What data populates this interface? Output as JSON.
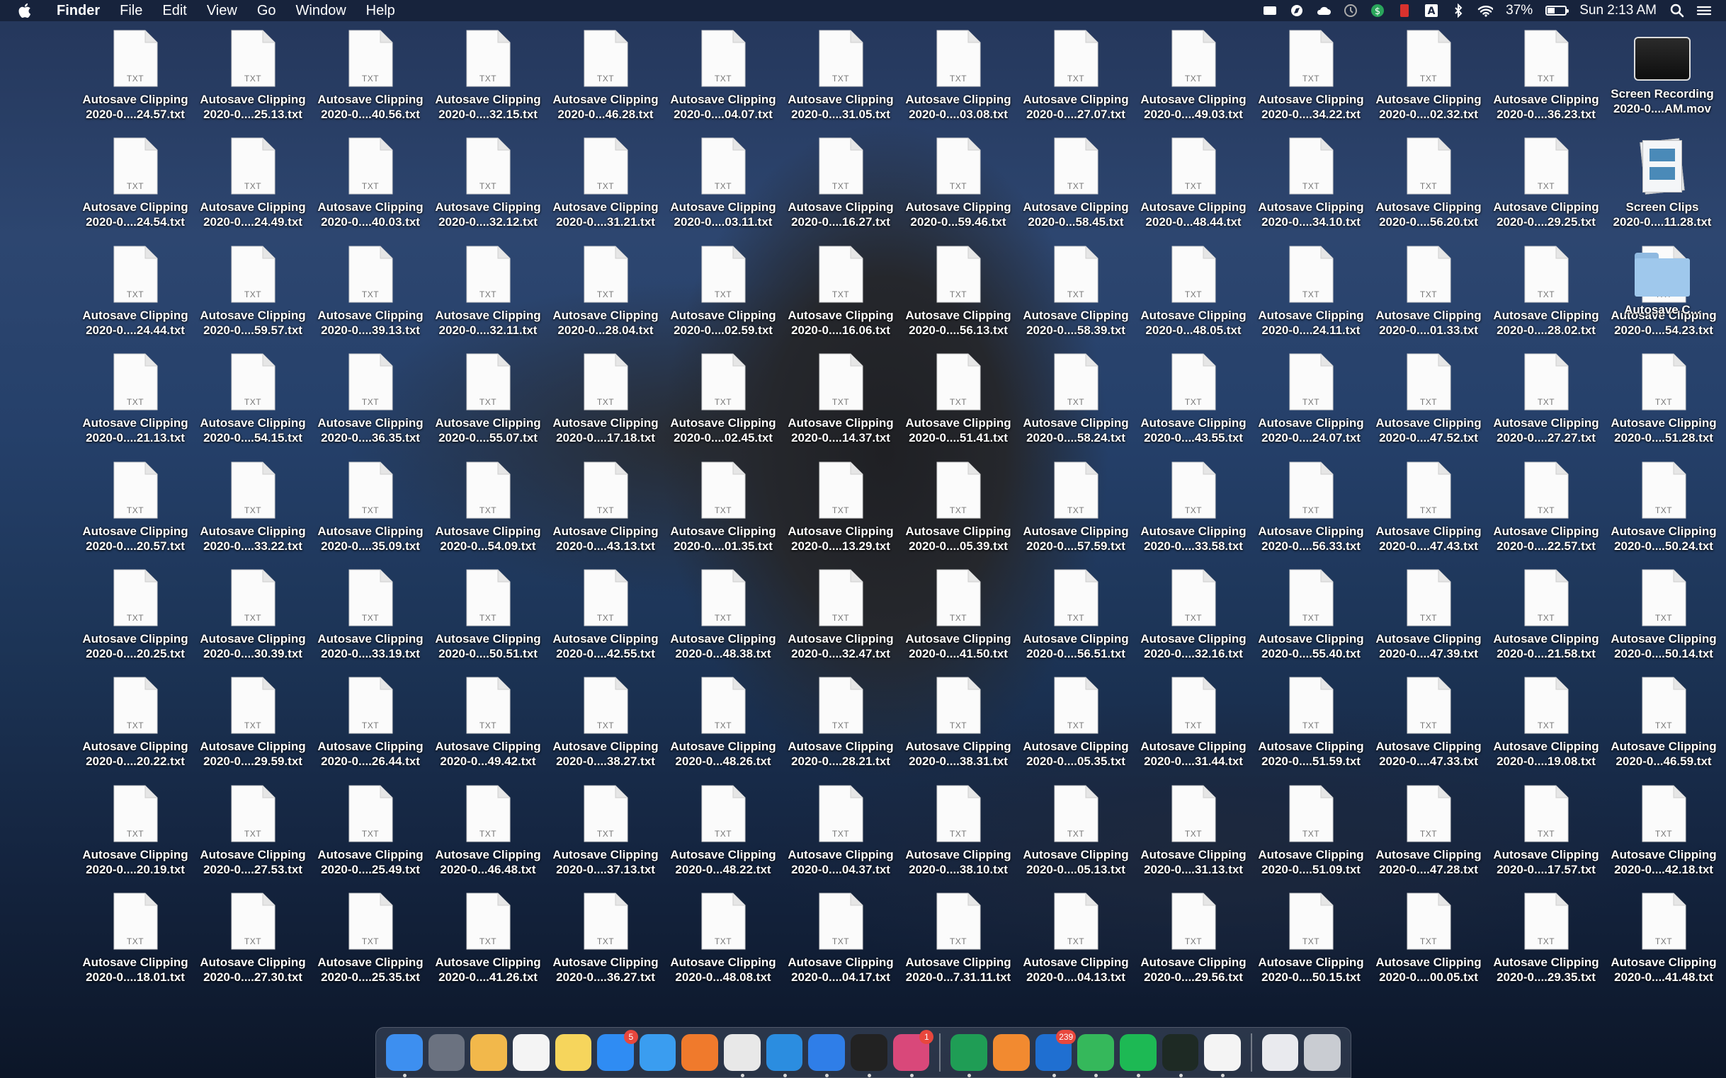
{
  "menubar": {
    "app_name": "Finder",
    "menus": [
      "File",
      "Edit",
      "View",
      "Go",
      "Window",
      "Help"
    ],
    "battery_percent": "37%",
    "battery_level": 0.37,
    "clock": "Sun 2:13 AM",
    "status_icons": [
      "display-icon",
      "compass-icon",
      "cloud-icon",
      "clock-icon",
      "dollar-icon",
      "bookmark-icon",
      "text-icon",
      "bluetooth-icon",
      "wifi-icon"
    ]
  },
  "file_ext": "TXT",
  "file_title": "Autosave Clipping",
  "grid": [
    [
      "2020-0....24.57.txt",
      "2020-0....25.13.txt",
      "2020-0....40.56.txt",
      "2020-0....32.15.txt",
      "2020-0...46.28.txt",
      "2020-0....04.07.txt",
      "2020-0....31.05.txt",
      "2020-0....03.08.txt",
      "2020-0....27.07.txt",
      "2020-0....49.03.txt",
      "2020-0....34.22.txt",
      "2020-0....02.32.txt",
      "2020-0....36.23.txt"
    ],
    [
      "2020-0....24.54.txt",
      "2020-0....24.49.txt",
      "2020-0....40.03.txt",
      "2020-0....32.12.txt",
      "2020-0....31.21.txt",
      "2020-0....03.11.txt",
      "2020-0....16.27.txt",
      "2020-0...59.46.txt",
      "2020-0...58.45.txt",
      "2020-0...48.44.txt",
      "2020-0....34.10.txt",
      "2020-0....56.20.txt",
      "2020-0....29.25.txt"
    ],
    [
      "2020-0....24.44.txt",
      "2020-0....59.57.txt",
      "2020-0....39.13.txt",
      "2020-0....32.11.txt",
      "2020-0...28.04.txt",
      "2020-0....02.59.txt",
      "2020-0....16.06.txt",
      "2020-0....56.13.txt",
      "2020-0....58.39.txt",
      "2020-0...48.05.txt",
      "2020-0....24.11.txt",
      "2020-0....01.33.txt",
      "2020-0....28.02.txt",
      "2020-0....54.23.txt"
    ],
    [
      "2020-0....21.13.txt",
      "2020-0....54.15.txt",
      "2020-0....36.35.txt",
      "2020-0....55.07.txt",
      "2020-0....17.18.txt",
      "2020-0....02.45.txt",
      "2020-0....14.37.txt",
      "2020-0....51.41.txt",
      "2020-0....58.24.txt",
      "2020-0....43.55.txt",
      "2020-0....24.07.txt",
      "2020-0....47.52.txt",
      "2020-0....27.27.txt",
      "2020-0....51.28.txt"
    ],
    [
      "2020-0....20.57.txt",
      "2020-0....33.22.txt",
      "2020-0....35.09.txt",
      "2020-0...54.09.txt",
      "2020-0....43.13.txt",
      "2020-0....01.35.txt",
      "2020-0....13.29.txt",
      "2020-0....05.39.txt",
      "2020-0....57.59.txt",
      "2020-0....33.58.txt",
      "2020-0....56.33.txt",
      "2020-0....47.43.txt",
      "2020-0....22.57.txt",
      "2020-0....50.24.txt"
    ],
    [
      "2020-0....20.25.txt",
      "2020-0....30.39.txt",
      "2020-0....33.19.txt",
      "2020-0....50.51.txt",
      "2020-0....42.55.txt",
      "2020-0...48.38.txt",
      "2020-0....32.47.txt",
      "2020-0....41.50.txt",
      "2020-0....56.51.txt",
      "2020-0....32.16.txt",
      "2020-0....55.40.txt",
      "2020-0....47.39.txt",
      "2020-0....21.58.txt",
      "2020-0....50.14.txt"
    ],
    [
      "2020-0....20.22.txt",
      "2020-0....29.59.txt",
      "2020-0....26.44.txt",
      "2020-0...49.42.txt",
      "2020-0....38.27.txt",
      "2020-0...48.26.txt",
      "2020-0....28.21.txt",
      "2020-0....38.31.txt",
      "2020-0....05.35.txt",
      "2020-0....31.44.txt",
      "2020-0....51.59.txt",
      "2020-0....47.33.txt",
      "2020-0....19.08.txt",
      "2020-0...46.59.txt"
    ],
    [
      "2020-0....20.19.txt",
      "2020-0....27.53.txt",
      "2020-0....25.49.txt",
      "2020-0...46.48.txt",
      "2020-0....37.13.txt",
      "2020-0...48.22.txt",
      "2020-0....04.37.txt",
      "2020-0....38.10.txt",
      "2020-0....05.13.txt",
      "2020-0....31.13.txt",
      "2020-0....51.09.txt",
      "2020-0....47.28.txt",
      "2020-0....17.57.txt",
      "2020-0....42.18.txt"
    ],
    [
      "2020-0....18.01.txt",
      "2020-0....27.30.txt",
      "2020-0....25.35.txt",
      "2020-0....41.26.txt",
      "2020-0....36.27.txt",
      "2020-0...48.08.txt",
      "2020-0....04.17.txt",
      "2020-0...7.31.11.txt",
      "2020-0....04.13.txt",
      "2020-0....29.56.txt",
      "2020-0....50.15.txt",
      "2020-0....00.05.txt",
      "2020-0....29.35.txt",
      "2020-0....41.48.txt"
    ]
  ],
  "right_column": [
    {
      "line1": "Screen Recording",
      "line2": "2020-0....AM.mov",
      "kind": "movie"
    },
    {
      "line1": "Screen Clips",
      "line2": "2020-0....11.28.txt",
      "kind": "stack"
    },
    {
      "line1": "Autosave C...",
      "line2": "",
      "kind": "folder"
    }
  ],
  "dock": {
    "items": [
      {
        "name": "finder-icon",
        "color": "#3d8ff0",
        "dot": true
      },
      {
        "name": "launchpad-icon",
        "color": "#6b7280",
        "dot": false
      },
      {
        "name": "photos-icon",
        "color": "#f2b84b",
        "dot": false
      },
      {
        "name": "reminders-icon",
        "color": "#f4f4f4",
        "dot": false
      },
      {
        "name": "notes-icon",
        "color": "#f6d55c",
        "dot": false
      },
      {
        "name": "app-store-icon",
        "color": "#2f8cf3",
        "dot": false,
        "badge": "5"
      },
      {
        "name": "safari-icon",
        "color": "#3a9df0",
        "dot": false
      },
      {
        "name": "firefox-icon",
        "color": "#f07a2c",
        "dot": false
      },
      {
        "name": "chrome-icon",
        "color": "#e8e8e8",
        "dot": true
      },
      {
        "name": "vscode-icon",
        "color": "#2b8de0",
        "dot": true
      },
      {
        "name": "maps-pin-icon",
        "color": "#2f7ee8",
        "dot": true
      },
      {
        "name": "terminal-icon",
        "color": "#222222",
        "dot": true
      },
      {
        "name": "cleanmymac-icon",
        "color": "#d9487a",
        "dot": true,
        "badge": "1"
      },
      {
        "sep": true
      },
      {
        "name": "robinhood-icon",
        "color": "#1f9d55",
        "dot": true
      },
      {
        "name": "pages-icon",
        "color": "#f28a30",
        "dot": false
      },
      {
        "name": "outlook-icon",
        "color": "#1f6fd1",
        "dot": true,
        "badge": "239"
      },
      {
        "name": "messages-icon",
        "color": "#35b85b",
        "dot": true
      },
      {
        "name": "spotify-icon",
        "color": "#1db954",
        "dot": true
      },
      {
        "name": "activity-monitor-icon",
        "color": "#1e2a24",
        "dot": true
      },
      {
        "name": "textedit-icon",
        "color": "#f4f4f4",
        "dot": true
      },
      {
        "sep": true
      },
      {
        "name": "documents-stack-icon",
        "color": "#e9eaee",
        "dot": false
      },
      {
        "name": "trash-icon",
        "color": "#c9ccd2",
        "dot": false
      }
    ]
  }
}
